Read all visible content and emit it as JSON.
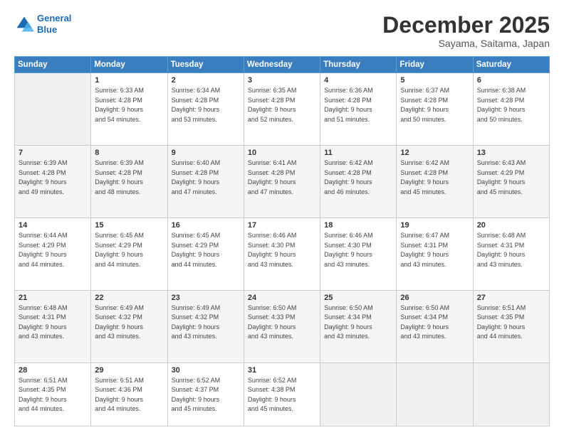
{
  "header": {
    "logo_line1": "General",
    "logo_line2": "Blue",
    "month_title": "December 2025",
    "location": "Sayama, Saitama, Japan"
  },
  "days_of_week": [
    "Sunday",
    "Monday",
    "Tuesday",
    "Wednesday",
    "Thursday",
    "Friday",
    "Saturday"
  ],
  "weeks": [
    [
      {
        "day": "",
        "info": ""
      },
      {
        "day": "1",
        "info": "Sunrise: 6:33 AM\nSunset: 4:28 PM\nDaylight: 9 hours\nand 54 minutes."
      },
      {
        "day": "2",
        "info": "Sunrise: 6:34 AM\nSunset: 4:28 PM\nDaylight: 9 hours\nand 53 minutes."
      },
      {
        "day": "3",
        "info": "Sunrise: 6:35 AM\nSunset: 4:28 PM\nDaylight: 9 hours\nand 52 minutes."
      },
      {
        "day": "4",
        "info": "Sunrise: 6:36 AM\nSunset: 4:28 PM\nDaylight: 9 hours\nand 51 minutes."
      },
      {
        "day": "5",
        "info": "Sunrise: 6:37 AM\nSunset: 4:28 PM\nDaylight: 9 hours\nand 50 minutes."
      },
      {
        "day": "6",
        "info": "Sunrise: 6:38 AM\nSunset: 4:28 PM\nDaylight: 9 hours\nand 50 minutes."
      }
    ],
    [
      {
        "day": "7",
        "info": "Sunrise: 6:39 AM\nSunset: 4:28 PM\nDaylight: 9 hours\nand 49 minutes."
      },
      {
        "day": "8",
        "info": "Sunrise: 6:39 AM\nSunset: 4:28 PM\nDaylight: 9 hours\nand 48 minutes."
      },
      {
        "day": "9",
        "info": "Sunrise: 6:40 AM\nSunset: 4:28 PM\nDaylight: 9 hours\nand 47 minutes."
      },
      {
        "day": "10",
        "info": "Sunrise: 6:41 AM\nSunset: 4:28 PM\nDaylight: 9 hours\nand 47 minutes."
      },
      {
        "day": "11",
        "info": "Sunrise: 6:42 AM\nSunset: 4:28 PM\nDaylight: 9 hours\nand 46 minutes."
      },
      {
        "day": "12",
        "info": "Sunrise: 6:42 AM\nSunset: 4:28 PM\nDaylight: 9 hours\nand 45 minutes."
      },
      {
        "day": "13",
        "info": "Sunrise: 6:43 AM\nSunset: 4:29 PM\nDaylight: 9 hours\nand 45 minutes."
      }
    ],
    [
      {
        "day": "14",
        "info": "Sunrise: 6:44 AM\nSunset: 4:29 PM\nDaylight: 9 hours\nand 44 minutes."
      },
      {
        "day": "15",
        "info": "Sunrise: 6:45 AM\nSunset: 4:29 PM\nDaylight: 9 hours\nand 44 minutes."
      },
      {
        "day": "16",
        "info": "Sunrise: 6:45 AM\nSunset: 4:29 PM\nDaylight: 9 hours\nand 44 minutes."
      },
      {
        "day": "17",
        "info": "Sunrise: 6:46 AM\nSunset: 4:30 PM\nDaylight: 9 hours\nand 43 minutes."
      },
      {
        "day": "18",
        "info": "Sunrise: 6:46 AM\nSunset: 4:30 PM\nDaylight: 9 hours\nand 43 minutes."
      },
      {
        "day": "19",
        "info": "Sunrise: 6:47 AM\nSunset: 4:31 PM\nDaylight: 9 hours\nand 43 minutes."
      },
      {
        "day": "20",
        "info": "Sunrise: 6:48 AM\nSunset: 4:31 PM\nDaylight: 9 hours\nand 43 minutes."
      }
    ],
    [
      {
        "day": "21",
        "info": "Sunrise: 6:48 AM\nSunset: 4:31 PM\nDaylight: 9 hours\nand 43 minutes."
      },
      {
        "day": "22",
        "info": "Sunrise: 6:49 AM\nSunset: 4:32 PM\nDaylight: 9 hours\nand 43 minutes."
      },
      {
        "day": "23",
        "info": "Sunrise: 6:49 AM\nSunset: 4:32 PM\nDaylight: 9 hours\nand 43 minutes."
      },
      {
        "day": "24",
        "info": "Sunrise: 6:50 AM\nSunset: 4:33 PM\nDaylight: 9 hours\nand 43 minutes."
      },
      {
        "day": "25",
        "info": "Sunrise: 6:50 AM\nSunset: 4:34 PM\nDaylight: 9 hours\nand 43 minutes."
      },
      {
        "day": "26",
        "info": "Sunrise: 6:50 AM\nSunset: 4:34 PM\nDaylight: 9 hours\nand 43 minutes."
      },
      {
        "day": "27",
        "info": "Sunrise: 6:51 AM\nSunset: 4:35 PM\nDaylight: 9 hours\nand 44 minutes."
      }
    ],
    [
      {
        "day": "28",
        "info": "Sunrise: 6:51 AM\nSunset: 4:35 PM\nDaylight: 9 hours\nand 44 minutes."
      },
      {
        "day": "29",
        "info": "Sunrise: 6:51 AM\nSunset: 4:36 PM\nDaylight: 9 hours\nand 44 minutes."
      },
      {
        "day": "30",
        "info": "Sunrise: 6:52 AM\nSunset: 4:37 PM\nDaylight: 9 hours\nand 45 minutes."
      },
      {
        "day": "31",
        "info": "Sunrise: 6:52 AM\nSunset: 4:38 PM\nDaylight: 9 hours\nand 45 minutes."
      },
      {
        "day": "",
        "info": ""
      },
      {
        "day": "",
        "info": ""
      },
      {
        "day": "",
        "info": ""
      }
    ]
  ]
}
